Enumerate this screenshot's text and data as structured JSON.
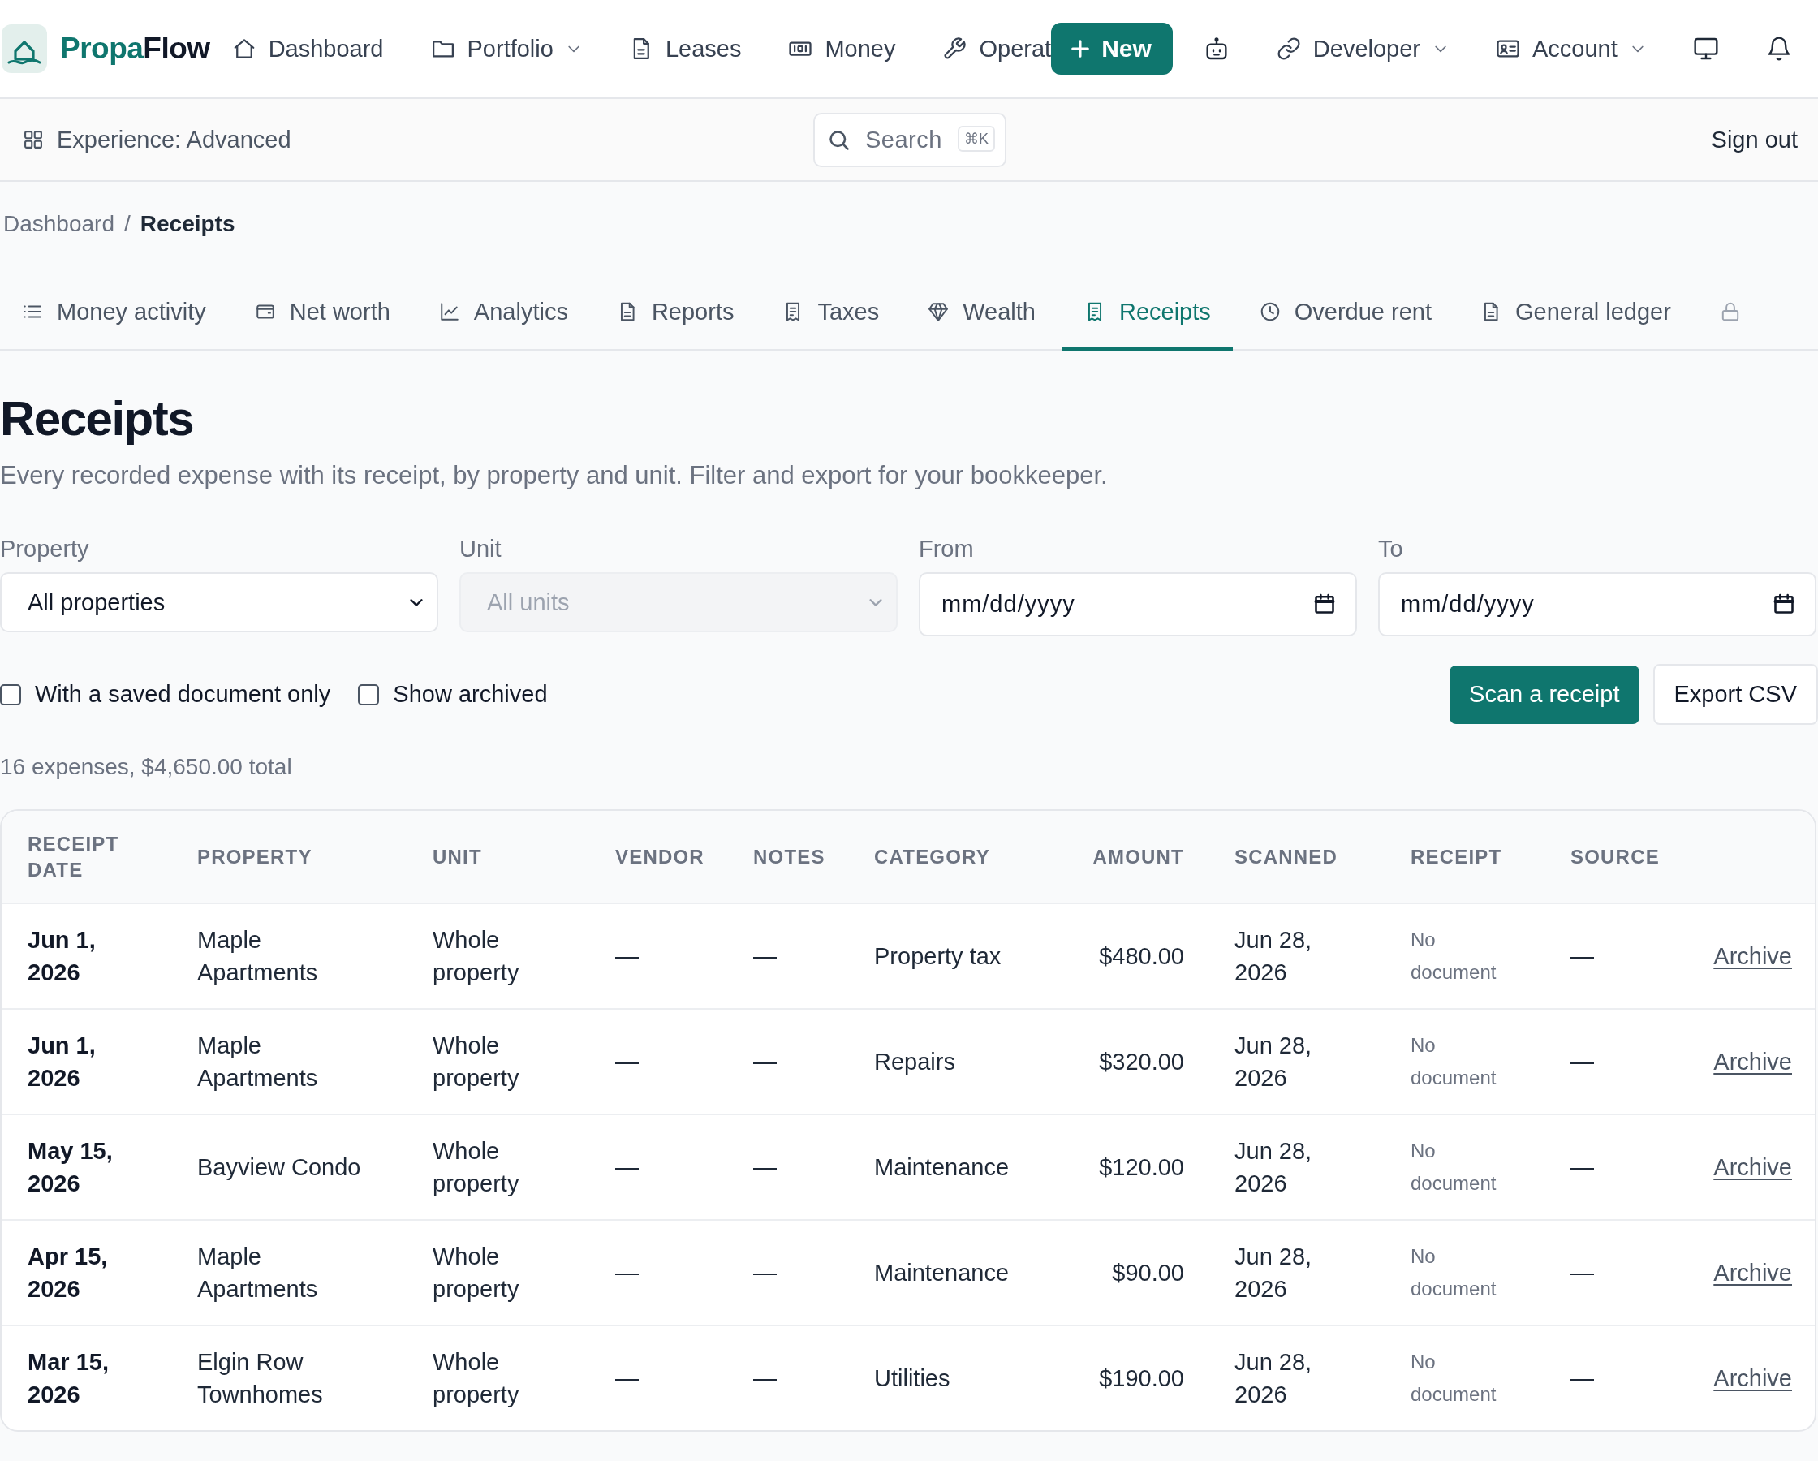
{
  "nav": {
    "brand": [
      "Propa",
      "Flow"
    ],
    "items": [
      {
        "kind": "link",
        "label": "Dashboard",
        "dropdown": false
      },
      {
        "kind": "link",
        "label": "Portfolio",
        "dropdown": true
      },
      {
        "kind": "link",
        "label": "Leases",
        "dropdown": false
      },
      {
        "kind": "link",
        "label": "Money",
        "dropdown": false
      },
      {
        "kind": "link",
        "label": "Operat",
        "dropdown": false
      },
      {
        "kind": "primary",
        "label": "New",
        "dropdown": false
      },
      {
        "kind": "icon"
      },
      {
        "kind": "link",
        "label": "Developer",
        "dropdown": true
      },
      {
        "kind": "link",
        "label": "Account",
        "dropdown": true
      },
      {
        "kind": "icon"
      },
      {
        "kind": "icon"
      }
    ]
  },
  "subbar": {
    "experience": "Experience: Advanced",
    "search": {
      "placeholder": "Search",
      "shortcut": "⌘K"
    },
    "sign_out": "Sign out"
  },
  "breadcrumb": {
    "separator": "/",
    "items": [
      {
        "label": "Dashboard",
        "current": false
      },
      {
        "label": "Receipts",
        "current": true
      }
    ]
  },
  "tabs": [
    {
      "label": "Money activity",
      "selected": false,
      "locked": false
    },
    {
      "label": "Net worth",
      "selected": false,
      "locked": false
    },
    {
      "label": "Analytics",
      "selected": false,
      "locked": false
    },
    {
      "label": "Reports",
      "selected": false,
      "locked": false
    },
    {
      "label": "Taxes",
      "selected": false,
      "locked": false
    },
    {
      "label": "Wealth",
      "selected": false,
      "locked": false
    },
    {
      "label": "Receipts",
      "selected": true,
      "locked": false
    },
    {
      "label": "Overdue rent",
      "selected": false,
      "locked": false
    },
    {
      "label": "General ledger",
      "selected": false,
      "locked": false
    },
    {
      "selected": false,
      "locked": true
    }
  ],
  "page": {
    "title": "Receipts",
    "subtitle": "Every recorded expense with its receipt, by property and unit. Filter and export for your bookkeeper."
  },
  "filters": [
    {
      "kind": "select",
      "label": "Property",
      "value": "All properties",
      "disabled": false
    },
    {
      "kind": "select",
      "label": "Unit",
      "value": "All units",
      "disabled": true
    },
    {
      "kind": "date",
      "label": "From",
      "placeholder": "mm/dd/yyyy",
      "disabled": false
    },
    {
      "kind": "date",
      "label": "To",
      "placeholder": "mm/dd/yyyy",
      "disabled": false
    }
  ],
  "checkboxes": [
    {
      "label": "With a saved document only",
      "checked": false
    },
    {
      "label": "Show archived",
      "checked": false
    }
  ],
  "buttons": [
    {
      "kind": "primary",
      "label": "Scan a receipt"
    },
    {
      "kind": "secondary",
      "label": "Export CSV"
    }
  ],
  "summary": "16 expenses, $4,650.00 total",
  "table": {
    "columns": [
      "RECEIPT DATE",
      "PROPERTY",
      "UNIT",
      "VENDOR",
      "NOTES",
      "CATEGORY",
      "AMOUNT",
      "SCANNED",
      "RECEIPT",
      "SOURCE"
    ],
    "rows": [
      {
        "cells": [
          "Jun 1, 2026",
          "Maple Apartments",
          "Whole property",
          "—",
          "—",
          "Property tax",
          "$480.00",
          "Jun 28, 2026",
          "No document",
          "—"
        ],
        "action": "Archive"
      },
      {
        "cells": [
          "Jun 1, 2026",
          "Maple Apartments",
          "Whole property",
          "—",
          "—",
          "Repairs",
          "$320.00",
          "Jun 28, 2026",
          "No document",
          "—"
        ],
        "action": "Archive"
      },
      {
        "cells": [
          "May 15, 2026",
          "Bayview Condo",
          "Whole property",
          "—",
          "—",
          "Maintenance",
          "$120.00",
          "Jun 28, 2026",
          "No document",
          "—"
        ],
        "action": "Archive"
      },
      {
        "cells": [
          "Apr 15, 2026",
          "Maple Apartments",
          "Whole property",
          "—",
          "—",
          "Maintenance",
          "$90.00",
          "Jun 28, 2026",
          "No document",
          "—"
        ],
        "action": "Archive"
      },
      {
        "cells": [
          "Mar 15, 2026",
          "Elgin Row Townhomes",
          "Whole property",
          "—",
          "—",
          "Utilities",
          "$190.00",
          "Jun 28, 2026",
          "No document",
          "—"
        ],
        "action": "Archive"
      }
    ]
  }
}
